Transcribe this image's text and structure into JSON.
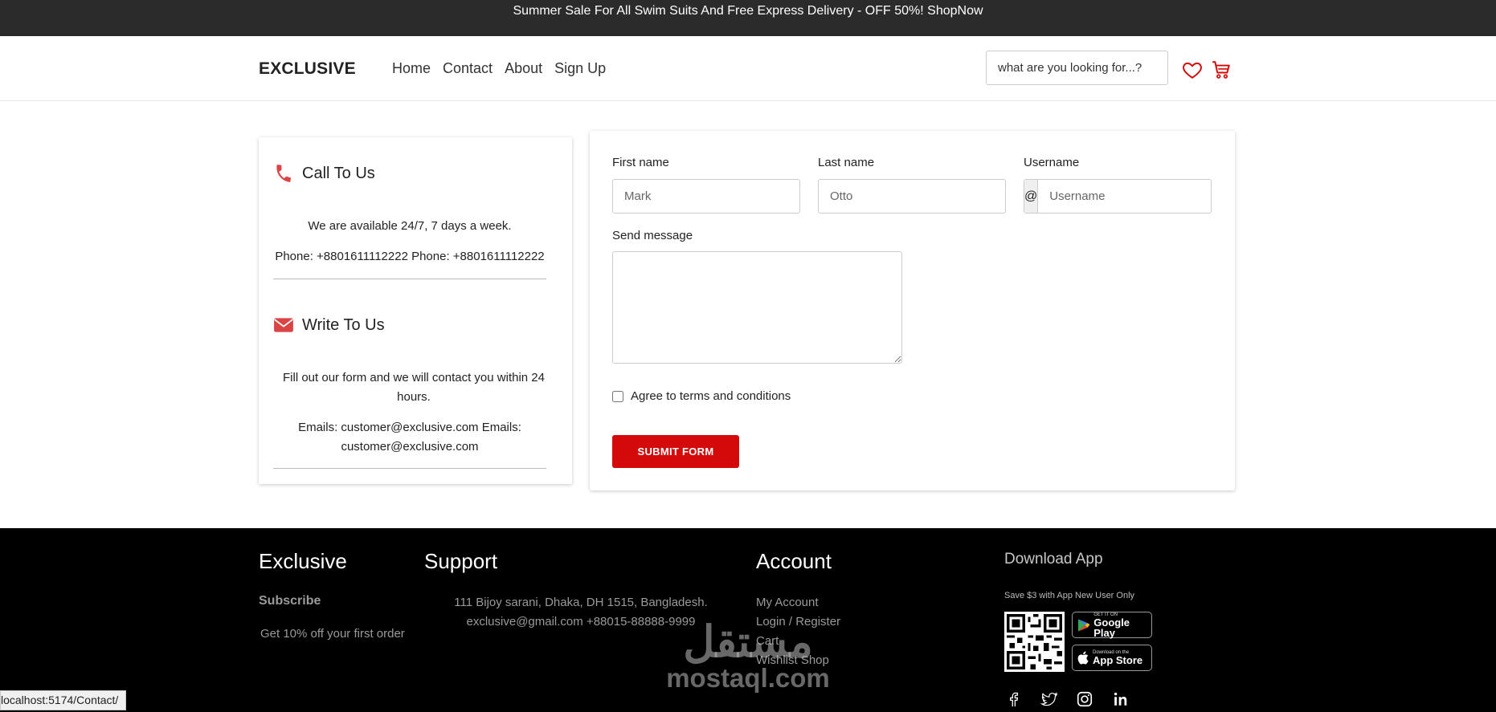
{
  "topbar": {
    "text": "Summer Sale For All Swim Suits And Free Express Delivery - OFF 50%! ShopNow"
  },
  "header": {
    "logo": "EXCLUSIVE",
    "nav": [
      "Home",
      "Contact",
      "About",
      "Sign Up"
    ],
    "search_placeholder": "what are you looking for...?",
    "icons": [
      "heart-icon",
      "cart-icon"
    ]
  },
  "contact": {
    "call_title": "Call To Us",
    "call_text": "We are available 24/7, 7 days a week.",
    "call_phone": "Phone: +8801611112222 Phone: +8801611112222",
    "write_title": "Write To Us",
    "write_text": "Fill out our form and we will contact you within 24 hours.",
    "write_emails": "Emails: customer@exclusive.com Emails: customer@exclusive.com",
    "accent": "#db4444"
  },
  "form": {
    "first_name_label": "First name",
    "first_name_placeholder": "Mark",
    "last_name_label": "Last name",
    "last_name_placeholder": "Otto",
    "username_label": "Username",
    "username_prefix": "@",
    "username_placeholder": "Username",
    "message_label": "Send message",
    "agree_label": "Agree to terms and conditions",
    "agree_checked": false,
    "submit_label": "SUBMIT FORM",
    "submit_color": "#d40a0a"
  },
  "footer": {
    "col1_title": "Exclusive",
    "col1_sub": "Subscribe",
    "col1_text": "Get 10% off your first order",
    "col2_title": "Support",
    "col2_address": "111 Bijoy sarani, Dhaka, DH 1515, Bangladesh.",
    "col2_contact": "exclusive@gmail.com +88015-88888-9999",
    "col3_title": "Account",
    "col3_links": [
      "My Account",
      "Login / Register",
      "Cart",
      "Wishlist Shop"
    ],
    "app_title": "Download App",
    "app_note": "Save $3 with App New User Only",
    "google_small": "GET IT ON",
    "google_big": "Google Play",
    "apple_small": "Download on the",
    "apple_big": "App Store",
    "socials": [
      "facebook-icon",
      "twitter-icon",
      "instagram-icon",
      "linkedin-icon"
    ]
  },
  "watermark": {
    "arabic": "مستقل",
    "latin": "mostaql.com"
  },
  "status_bar": {
    "url": "localhost:5174/Contact/"
  }
}
